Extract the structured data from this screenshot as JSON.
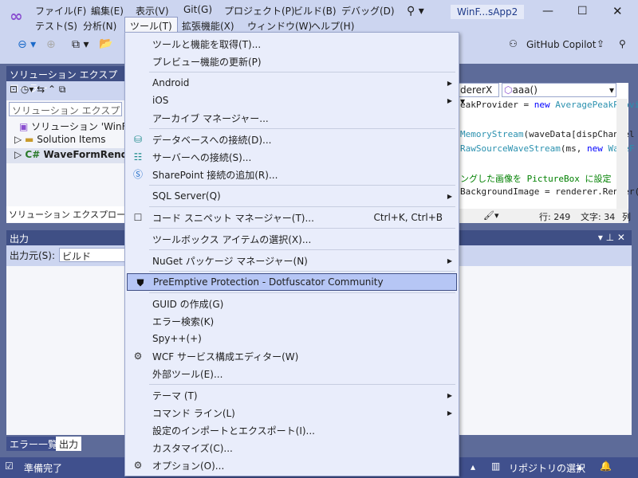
{
  "menubar": {
    "row1": [
      "ファイル(F)",
      "編集(E)",
      "表示(V)",
      "Git(G)",
      "プロジェクト(P)",
      "ビルド(B)",
      "デバッグ(D)"
    ],
    "row2": [
      "テスト(S)",
      "分析(N)",
      "ツール(T)",
      "拡張機能(X)",
      "ウィンドウ(W)",
      "ヘルプ(H)"
    ]
  },
  "window": {
    "title": "WinF...sApp2"
  },
  "toolbar": {
    "copilot": "GitHub Copilot"
  },
  "solution_explorer": {
    "title": "ソリューション エクスプローラー",
    "search_placeholder": "ソリューション エクスプローラー の",
    "items": [
      "ソリューション 'WinForm",
      "Solution Items",
      "WaveFormRender"
    ],
    "tab": "ソリューション エクスプローラー"
  },
  "editor": {
    "member_dropdown": "dererX",
    "method_dropdown": "aaa()",
    "lines": [
      {
        "parts": [
          [
            "",
            "eakProvider = "
          ],
          [
            "kw",
            "new "
          ],
          [
            "ty",
            "AveragePeakProvi"
          ]
        ]
      },
      {
        "parts": [
          [
            "ty",
            "MemoryStream"
          ],
          [
            "",
            "(waveData[dispChannel"
          ]
        ]
      },
      {
        "parts": [
          [
            "ty",
            "RawSourceWaveStream"
          ],
          [
            "",
            "(ms, "
          ],
          [
            "kw",
            "new "
          ],
          [
            "ty",
            "WaveF"
          ]
        ]
      },
      {
        "parts": [
          [
            "cm",
            "ングした画像を PictureBox に設定"
          ]
        ]
      },
      {
        "parts": [
          [
            "",
            "BackgroundImage = renderer.Render("
          ]
        ]
      }
    ],
    "status": {
      "line": "行: 249",
      "char": "文字: 34",
      "col": "列"
    }
  },
  "output": {
    "title": "出力",
    "source_label": "出力元(S):",
    "source_value": "ビルド",
    "tabs": [
      "エラー一覧",
      "出力"
    ]
  },
  "tools_menu": [
    {
      "label": "ツールと機能を取得(T)..."
    },
    {
      "label": "プレビュー機能の更新(P)"
    },
    {
      "sep": true
    },
    {
      "label": "Android",
      "sub": true
    },
    {
      "label": "iOS",
      "sub": true
    },
    {
      "label": "アーカイブ マネージャー..."
    },
    {
      "sep": true
    },
    {
      "label": "データベースへの接続(D)...",
      "icon": "database-connect-icon"
    },
    {
      "label": "サーバーへの接続(S)...",
      "icon": "server-connect-icon"
    },
    {
      "label": "SharePoint 接続の追加(R)...",
      "icon": "sharepoint-icon"
    },
    {
      "sep": true
    },
    {
      "label": "SQL Server(Q)",
      "sub": true
    },
    {
      "sep": true
    },
    {
      "label": "コード スニペット マネージャー(T)...",
      "icon": "snippet-icon",
      "shortcut": "Ctrl+K, Ctrl+B"
    },
    {
      "sep": true
    },
    {
      "label": "ツールボックス アイテムの選択(X)..."
    },
    {
      "sep": true
    },
    {
      "label": "NuGet パッケージ マネージャー(N)",
      "sub": true
    },
    {
      "sep": true
    },
    {
      "label": "PreEmptive Protection - Dotfuscator Community",
      "icon": "shield-icon",
      "highlight": true
    },
    {
      "sep": true
    },
    {
      "label": "GUID の作成(G)"
    },
    {
      "label": "エラー検索(K)"
    },
    {
      "label": "Spy++(+)"
    },
    {
      "label": "WCF サービス構成エディター(W)",
      "icon": "wcf-gear-icon"
    },
    {
      "label": "外部ツール(E)..."
    },
    {
      "sep": true
    },
    {
      "label": "テーマ (T)",
      "sub": true
    },
    {
      "label": "コマンド ライン(L)",
      "sub": true
    },
    {
      "label": "設定のインポートとエクスポート(I)..."
    },
    {
      "label": "カスタマイズ(C)..."
    },
    {
      "label": "オプション(O)...",
      "icon": "gear-icon"
    }
  ],
  "statusbar": {
    "ready": "準備完了",
    "repo": "リポジトリの選択"
  }
}
